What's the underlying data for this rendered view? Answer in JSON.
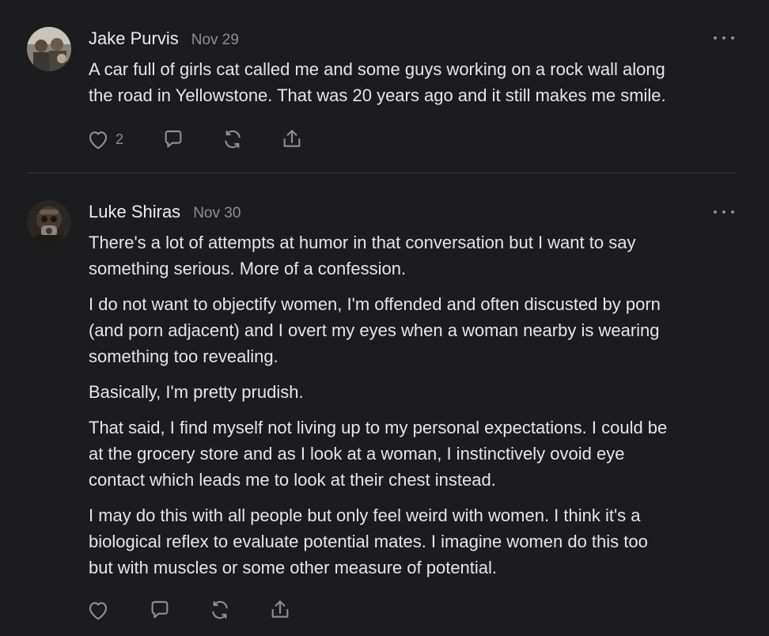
{
  "comments": [
    {
      "author": "Jake Purvis",
      "date": "Nov 29",
      "avatar_icon": "user-avatar-group",
      "lines": [
        "A car full of girls cat called me and some guys working on a rock wall along",
        "the road in Yellowstone. That was 20 years ago and it still makes me smile."
      ],
      "like_count": "2",
      "icons": [
        "heart-icon",
        "comment-icon",
        "restack-icon",
        "share-icon",
        "more-icon"
      ]
    },
    {
      "author": "Luke Shiras",
      "date": "Nov 30",
      "avatar_icon": "user-avatar-mask",
      "paragraphs": [
        [
          "There's a lot of attempts at humor in that conversation but I want to say",
          "something serious. More of a confession."
        ],
        [
          "I do not want to objectify women, I'm offended and often discusted by porn",
          "(and porn adjacent) and I overt my eyes when a woman nearby is wearing",
          "something too revealing."
        ],
        [
          "Basically, I'm pretty prudish."
        ],
        [
          "That said, I find myself not living up to my personal expectations. I could be",
          "at the grocery store and as I look at a woman, I instinctively ovoid eye",
          "contact which leads me to look at their chest instead."
        ],
        [
          "I may do this with all people but only feel weird with women. I think it's a",
          "biological reflex to evaluate potential mates. I imagine women do this too",
          "but with muscles or some other measure of potential."
        ]
      ],
      "icons": [
        "heart-icon",
        "comment-icon",
        "restack-icon",
        "share-icon",
        "more-icon"
      ]
    }
  ],
  "colors": {
    "background": "#1c1c1e",
    "text": "#e6e6e8",
    "muted": "#8e8e93",
    "divider": "#38383a"
  }
}
